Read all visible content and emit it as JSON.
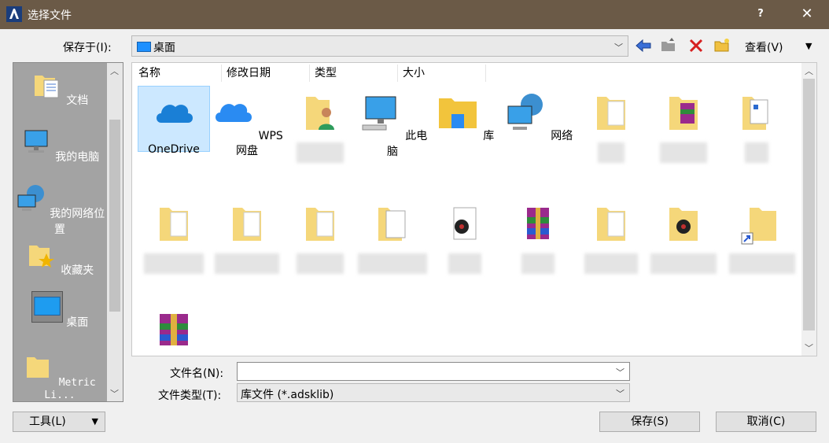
{
  "window": {
    "title": "选择文件",
    "help": "?",
    "close": "✕"
  },
  "lookin": {
    "label": "保存于(I):",
    "value": "桌面"
  },
  "toolbar": {
    "view_label": "查看(V)"
  },
  "places": [
    {
      "label": "文档",
      "icon": "documents-icon"
    },
    {
      "label": "我的电脑",
      "icon": "computer-icon"
    },
    {
      "label": "我的网络位置",
      "icon": "network-icon"
    },
    {
      "label": "收藏夹",
      "icon": "favorites-icon"
    },
    {
      "label": "桌面",
      "icon": "desktop-icon"
    },
    {
      "label": "Metric Li...",
      "icon": "folder-icon"
    }
  ],
  "columns": [
    "名称",
    "修改日期",
    "类型",
    "大小"
  ],
  "files": [
    {
      "label": "OneDrive",
      "icon": "onedrive-icon"
    },
    {
      "label": "WPS网盘",
      "icon": "cloud-icon"
    },
    {
      "label": "",
      "icon": "user-folder-icon"
    },
    {
      "label": "此电脑",
      "icon": "computer-icon"
    },
    {
      "label": "库",
      "icon": "library-icon"
    },
    {
      "label": "网络",
      "icon": "network-icon"
    },
    {
      "label": "",
      "icon": "folder-icon"
    },
    {
      "label": "",
      "icon": "archive-folder-icon"
    },
    {
      "label": "",
      "icon": "document-icon"
    },
    {
      "label": "",
      "icon": "folder-icon"
    },
    {
      "label": "",
      "icon": "folder-icon"
    },
    {
      "label": "",
      "icon": "folder-icon"
    },
    {
      "label": "",
      "icon": "document-icon"
    },
    {
      "label": "",
      "icon": "media-file-icon"
    },
    {
      "label": "",
      "icon": "archive-icon"
    },
    {
      "label": "",
      "icon": "folder-icon"
    },
    {
      "label": "",
      "icon": "media-folder-icon"
    },
    {
      "label": "",
      "icon": "shortcut-folder-icon"
    },
    {
      "label": "",
      "icon": "archive-icon"
    }
  ],
  "filename": {
    "label": "文件名(N):",
    "value": ""
  },
  "filetype": {
    "label": "文件类型(T):",
    "value": "库文件  (*.adsklib)"
  },
  "buttons": {
    "tools": "工具(L)",
    "save": "保存(S)",
    "cancel": "取消(C)"
  }
}
